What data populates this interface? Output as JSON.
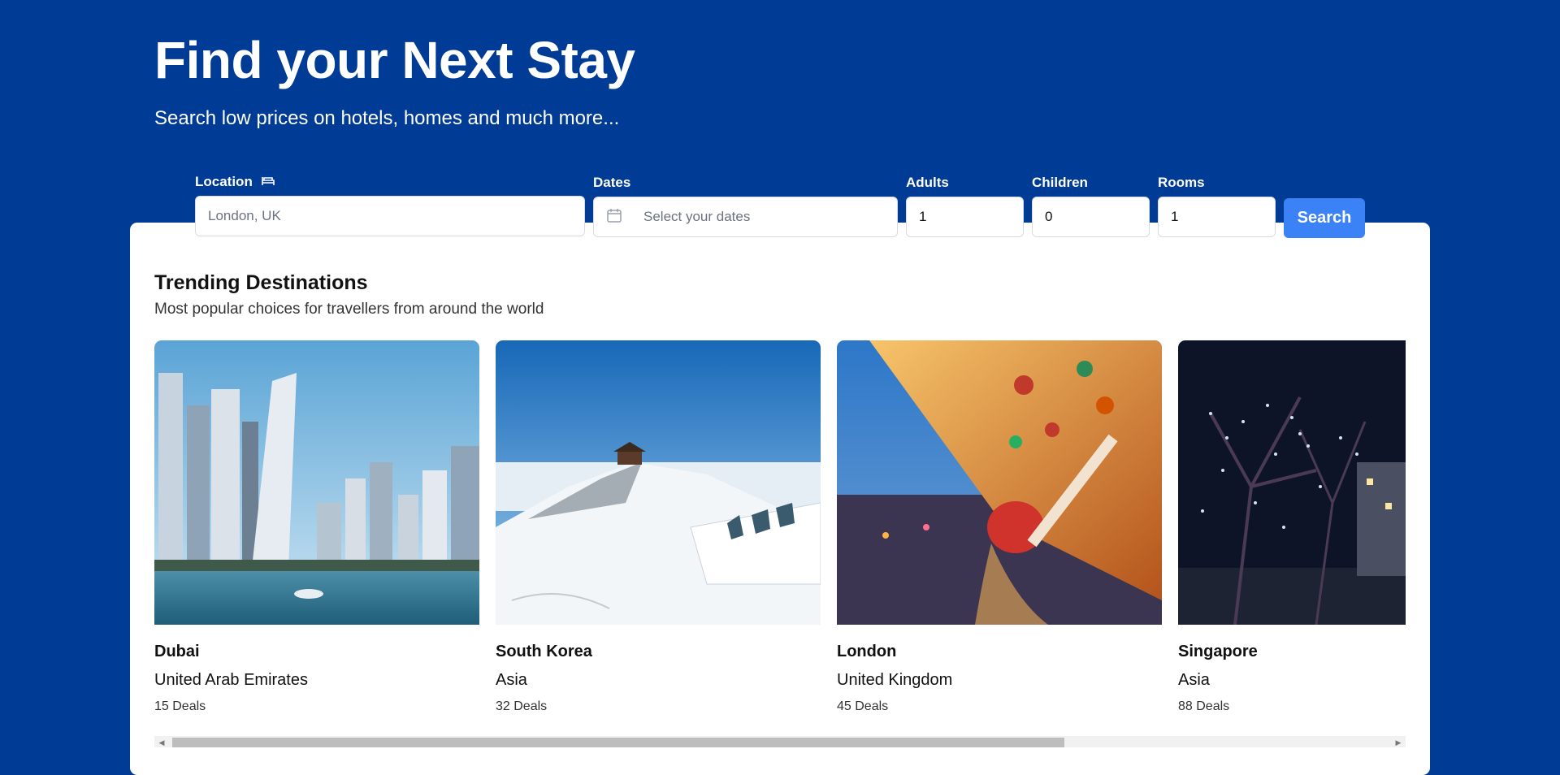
{
  "hero": {
    "title": "Find your Next Stay",
    "subtitle": "Search low prices on hotels, homes and much more..."
  },
  "search": {
    "location_label": "Location",
    "location_placeholder": "London, UK",
    "dates_label": "Dates",
    "dates_placeholder": "Select your dates",
    "adults_label": "Adults",
    "adults_value": "1",
    "children_label": "Children",
    "children_value": "0",
    "rooms_label": "Rooms",
    "rooms_value": "1",
    "button_label": "Search"
  },
  "trending": {
    "title": "Trending Destinations",
    "subtitle": "Most popular choices for travellers from around the world",
    "destinations": [
      {
        "name": "Dubai",
        "region": "United Arab Emirates",
        "deals": "15 Deals"
      },
      {
        "name": "South Korea",
        "region": "Asia",
        "deals": "32 Deals"
      },
      {
        "name": "London",
        "region": "United Kingdom",
        "deals": "45 Deals"
      },
      {
        "name": "Singapore",
        "region": "Asia",
        "deals": "88 Deals"
      }
    ]
  },
  "colors": {
    "brand": "#003b95",
    "accent": "#3b82f6"
  }
}
